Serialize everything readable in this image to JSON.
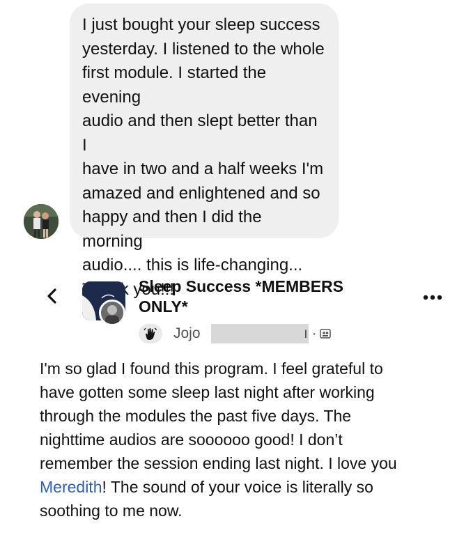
{
  "message": {
    "lines": [
      "I just bought your sleep success",
      "yesterday. I listened to the whole",
      "first module. I started the evening",
      "audio and then slept better than I",
      "have in two and a half weeks I'm",
      "amazed and enlightened and so",
      "happy and then I did the morning",
      "audio.... this is life-changing...",
      "Thank you!!!"
    ]
  },
  "post": {
    "group_name_line1": "Sleep Success *MEMBERS",
    "group_name_line2": "ONLY*",
    "author": "Jojo",
    "meta_suffix": "ı ·",
    "body_lines": [
      "I'm so glad I found this program. I feel grateful to",
      "have gotten some sleep last night after working",
      "through the modules the past five days. The",
      "nighttime audios are soooooo good! I don’t",
      "remember the session ending last night. I love you"
    ],
    "mention": "Meredith",
    "body_after_mention": "! The sound of your voice is literally so",
    "body_last_line": "soothing to me now."
  },
  "icons": {
    "back": "chevron-left-icon",
    "more": "more-options-icon",
    "wave": "waving-hand-icon",
    "audience": "group-audience-icon"
  },
  "colors": {
    "bubble": "#efefef",
    "mention": "#2f5fb3",
    "redaction": "#d8d8d8"
  }
}
